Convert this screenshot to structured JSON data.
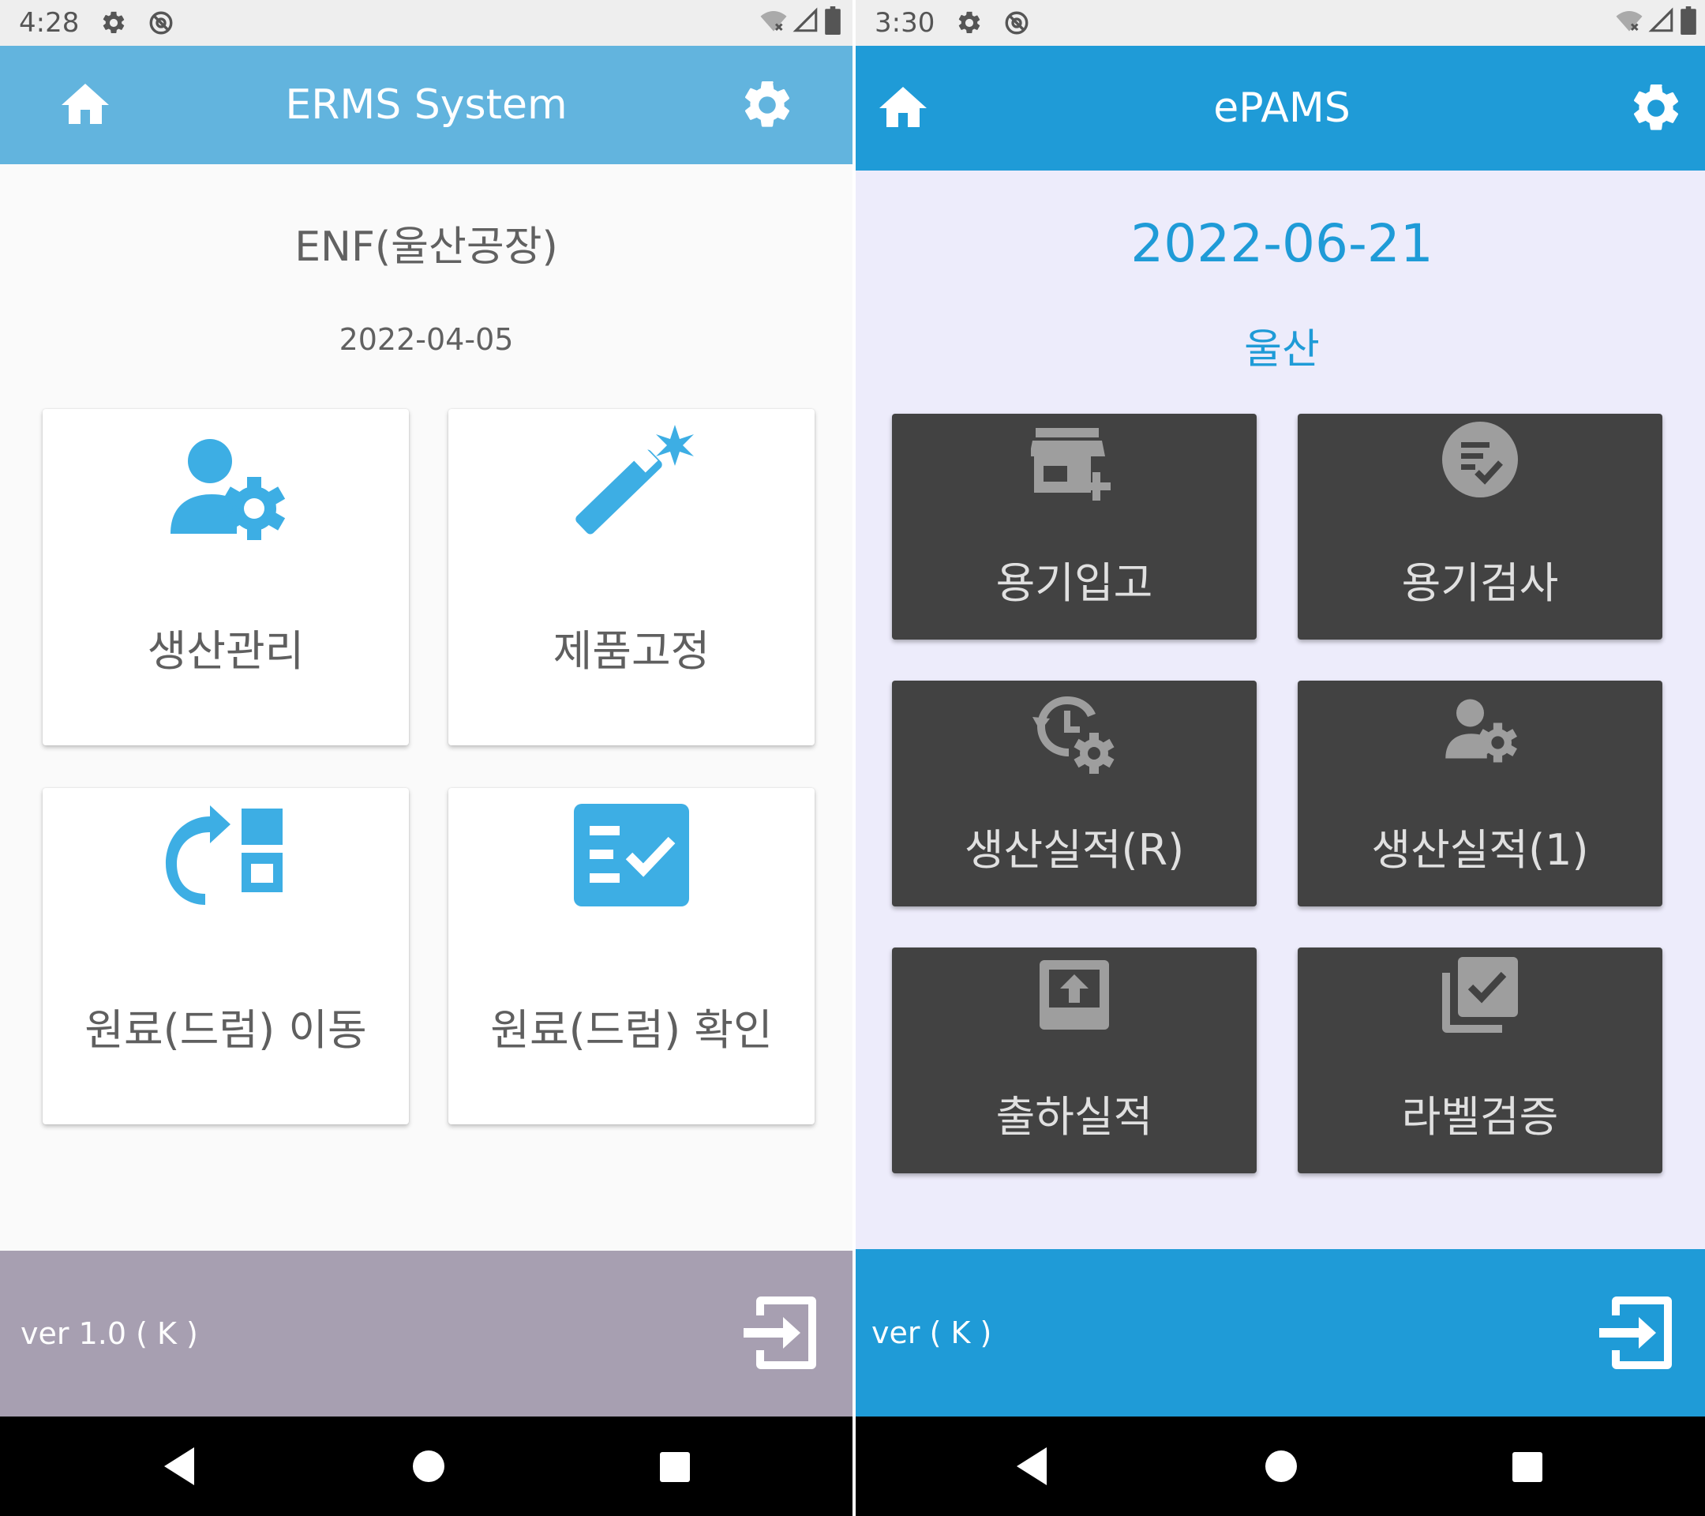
{
  "left": {
    "status_bar": {
      "time": "4:28"
    },
    "app_bar": {
      "title": "ERMS System",
      "color": "#62b4de"
    },
    "company": "ENF(울산공장)",
    "date": "2022-04-05",
    "menu": [
      {
        "label": "생산관리",
        "icon": "user-settings-icon"
      },
      {
        "label": "제품고정",
        "icon": "magic-wand-icon"
      },
      {
        "label": "원료(드럼) 이동",
        "icon": "move-items-icon"
      },
      {
        "label": "원료(드럼) 확인",
        "icon": "checklist-icon"
      }
    ],
    "footer": {
      "version": "ver 1.0 ( K )",
      "color": "#a79fb1"
    }
  },
  "right": {
    "status_bar": {
      "time": "3:30"
    },
    "app_bar": {
      "title": "ePAMS",
      "color": "#1f9bd7"
    },
    "date": "2022-06-21",
    "site": "울산",
    "menu": [
      {
        "label": "용기입고",
        "icon": "store-add-icon"
      },
      {
        "label": "용기검사",
        "icon": "check-circle-list-icon"
      },
      {
        "label": "생산실적(R)",
        "icon": "history-settings-icon"
      },
      {
        "label": "생산실적(1)",
        "icon": "user-settings-icon"
      },
      {
        "label": "출하실적",
        "icon": "upload-tray-icon"
      },
      {
        "label": "라벨검증",
        "icon": "library-check-icon"
      }
    ],
    "footer": {
      "version": "ver ( K )",
      "color": "#1f9bd7"
    }
  },
  "colors": {
    "accent_light": "#3daee4",
    "card_dark": "#424242",
    "icon_gray": "#9e9e9e",
    "label_gray": "#5f5f5f",
    "label_light": "#e0e0e0"
  }
}
